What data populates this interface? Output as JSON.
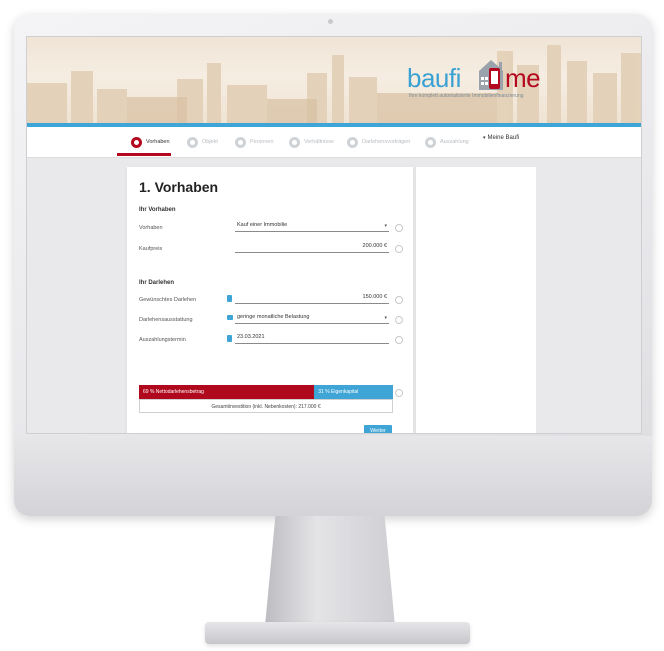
{
  "brand": {
    "logo_part1": "baufi",
    "logo_part2": "me",
    "tagline": "Ihre komplett automatisierte Immobilienfinanzierung",
    "colors": {
      "primary_red": "#b0081d",
      "accent_blue": "#3ea5d6"
    }
  },
  "steps": [
    {
      "label": "Vorhaben",
      "icon": "house-step-icon",
      "active": true
    },
    {
      "label": "Objekt",
      "icon": "building-step-icon",
      "active": false
    },
    {
      "label": "Personen",
      "icon": "person-step-icon",
      "active": false
    },
    {
      "label": "Verhältnisse",
      "icon": "finance-step-icon",
      "active": false
    },
    {
      "label": "Darlehensvorträgen",
      "icon": "contract-step-icon",
      "active": false
    },
    {
      "label": "Auszahlung",
      "icon": "payout-step-icon",
      "active": false
    }
  ],
  "account_menu": {
    "label": "Meine Baufi"
  },
  "form": {
    "title": "1. Vorhaben",
    "section_vorhaben": "Ihr Vorhaben",
    "vorhaben_label": "Vorhaben",
    "vorhaben_value": "Kauf einer Immobilie",
    "kaufpreis_label": "Kaufpreis",
    "kaufpreis_value": "200.000 €",
    "section_darlehen": "Ihr Darlehen",
    "darlehen_label": "Gewünschtes Darlehen",
    "darlehen_value": "150.000 €",
    "ausstattung_label": "Darlehensausstattung",
    "ausstattung_value": "geringe monatliche Belastung",
    "termin_label": "Auszahlungstermin",
    "termin_value": "23.03.2021",
    "bar_red_text": "69 % Nettodarlehensbetrag",
    "bar_blue_text": "31 % Eigenkapital",
    "bar_red_share": 0.69,
    "total_text": "Gesamtinvestition (inkl. Nebenkosten): 217.000 €",
    "submit_label": "Weiter"
  }
}
